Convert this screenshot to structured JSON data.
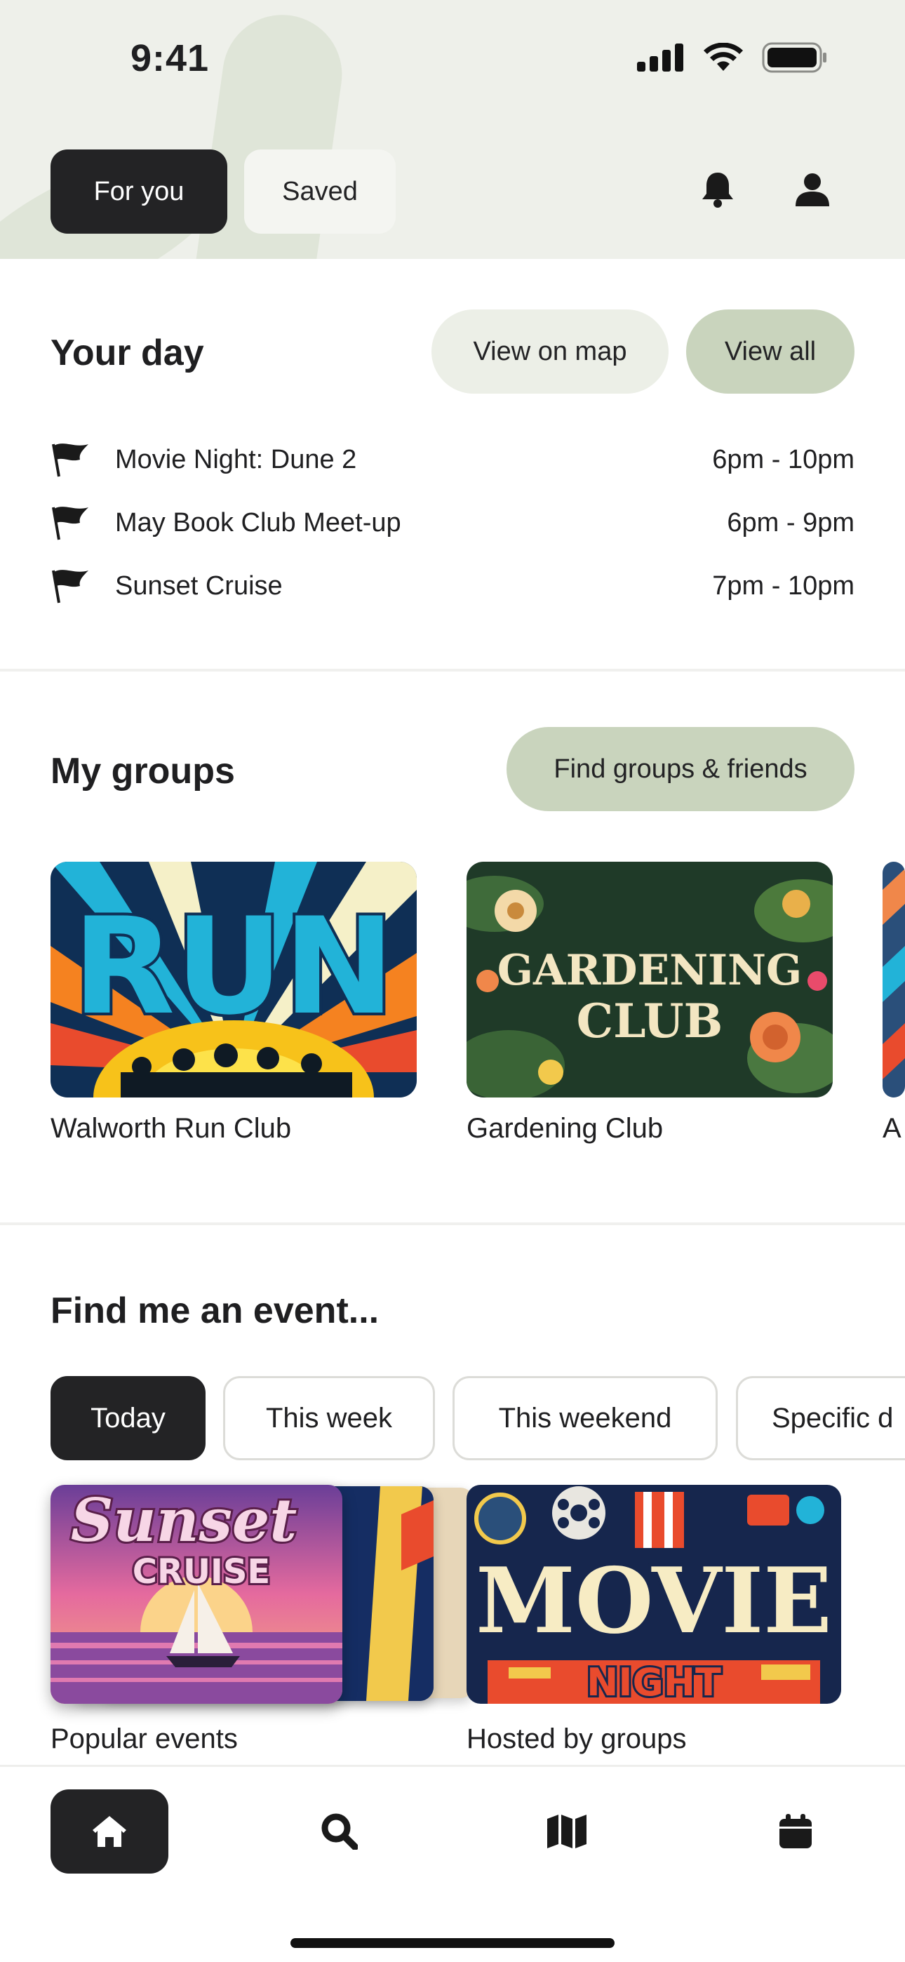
{
  "status_bar": {
    "time": "9:41"
  },
  "header": {
    "tabs": [
      {
        "label": "For you",
        "active": true
      },
      {
        "label": "Saved",
        "active": false
      }
    ],
    "icons": [
      "bell-icon",
      "profile-icon"
    ]
  },
  "your_day": {
    "title": "Your day",
    "view_on_map_label": "View on map",
    "view_all_label": "View all",
    "events": [
      {
        "name": "Movie Night: Dune 2",
        "time": "6pm - 10pm",
        "icon": "flag-icon"
      },
      {
        "name": "May Book Club Meet-up",
        "time": "6pm - 9pm",
        "icon": "flag-icon"
      },
      {
        "name": "Sunset Cruise",
        "time": "7pm - 10pm",
        "icon": "flag-icon"
      }
    ]
  },
  "my_groups": {
    "title": "My groups",
    "find_button_label": "Find groups & friends",
    "groups": [
      {
        "name": "Walworth Run Club",
        "image_text": "RUN"
      },
      {
        "name": "Gardening Club",
        "image_text_1": "GARDENING",
        "image_text_2": "CLUB"
      },
      {
        "name": "A"
      }
    ]
  },
  "find_event": {
    "title": "Find me an event...",
    "filters": [
      {
        "label": "Today",
        "active": true
      },
      {
        "label": "This week",
        "active": false
      },
      {
        "label": "This weekend",
        "active": false
      },
      {
        "label": "Specific d",
        "active": false
      }
    ],
    "cards": [
      {
        "label": "Popular events",
        "image_text_1": "Sunset",
        "image_text_2": "CRUISE"
      },
      {
        "label": "Hosted by groups",
        "image_text_1": "MOVIE",
        "image_text_2": "NIGHT"
      }
    ]
  },
  "bottom_nav": {
    "items": [
      {
        "icon": "home-icon",
        "active": true
      },
      {
        "icon": "search-icon",
        "active": false
      },
      {
        "icon": "map-icon",
        "active": false
      },
      {
        "icon": "calendar-icon",
        "active": false
      }
    ]
  },
  "colors": {
    "dark": "#232325",
    "sage": "#c9d4bd",
    "light_pill": "#ecefe7",
    "header_bg": "#eef0ea"
  }
}
